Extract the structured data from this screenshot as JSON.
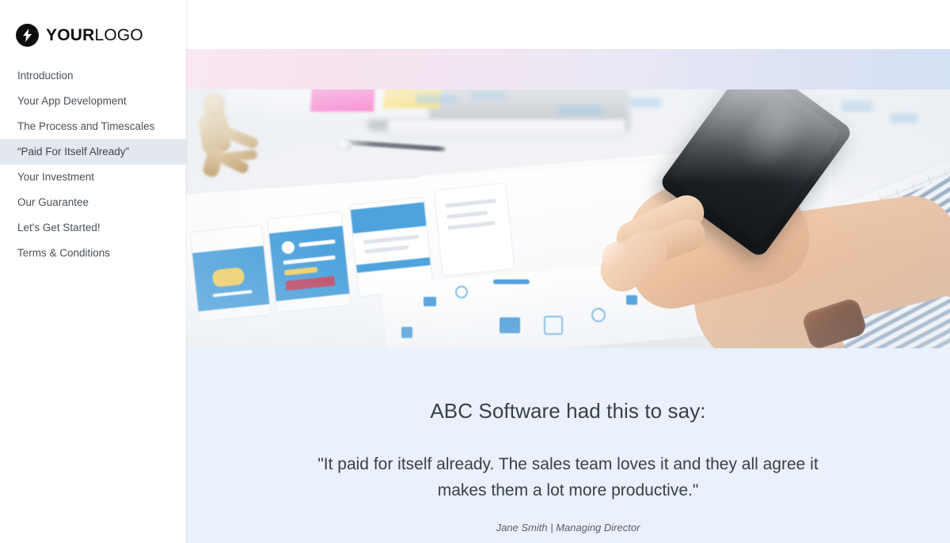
{
  "brand": {
    "logo_icon": "lightning-bolt-icon",
    "name_bold": "YOUR",
    "name_light": "LOGO"
  },
  "sidebar": {
    "items": [
      {
        "label": "Introduction",
        "active": false
      },
      {
        "label": "Your App Development",
        "active": false
      },
      {
        "label": "The Process and Timescales",
        "active": false
      },
      {
        "label": "“Paid For Itself Already”",
        "active": true
      },
      {
        "label": "Your Investment",
        "active": false
      },
      {
        "label": "Our Guarantee",
        "active": false
      },
      {
        "label": "Let's Get Started!",
        "active": false
      },
      {
        "label": "Terms & Conditions",
        "active": false
      }
    ]
  },
  "hero": {
    "gradient_start": "#f9e8f3",
    "gradient_end": "#d4e0f4",
    "photo_alt": "Hands holding a smartphone over a desk with app wireframe printouts, keyboard, wooden mannequin and sticky notes"
  },
  "testimonial": {
    "background": "#e8f1fc",
    "heading": "ABC Software had this to say:",
    "quote": "\"It paid for itself already. The sales team loves it and they all agree it makes them a lot more productive.\"",
    "attribution": "Jane Smith | Managing Director"
  }
}
